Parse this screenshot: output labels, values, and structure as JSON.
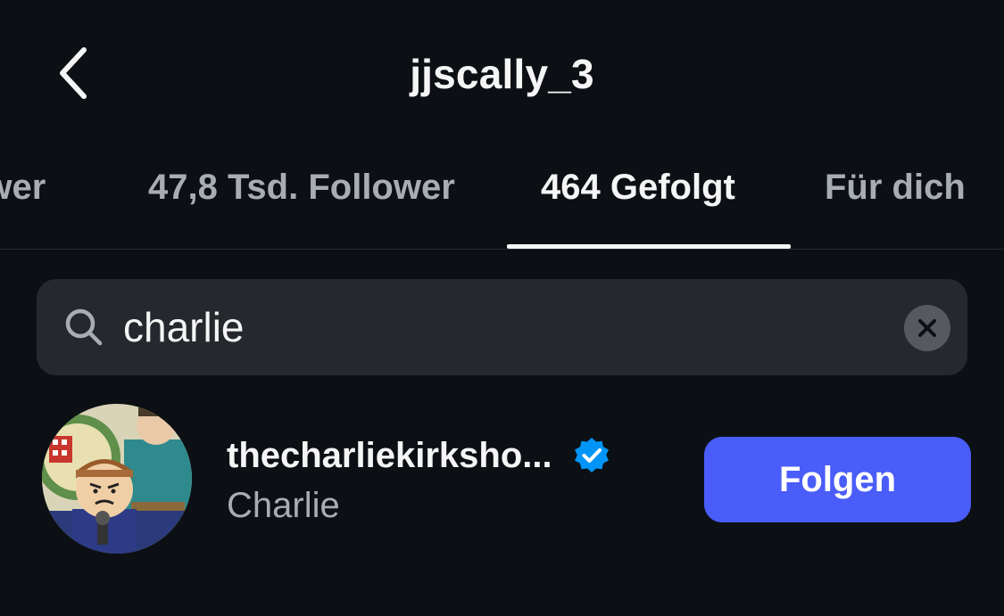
{
  "header": {
    "title": "jjscally_3",
    "back_icon": "chevron-left-icon"
  },
  "tabs": [
    {
      "label": "ower",
      "active": false
    },
    {
      "label": "47,8 Tsd. Follower",
      "active": false
    },
    {
      "label": "464 Gefolgt",
      "active": true
    },
    {
      "label": "Für dich",
      "active": false
    }
  ],
  "search": {
    "value": "charlie",
    "icon": "search-icon",
    "clear_icon": "close-icon"
  },
  "results": [
    {
      "username": "thecharliekirksho...",
      "verified": true,
      "full_name": "Charlie",
      "follow_label": "Folgen"
    }
  ],
  "colors": {
    "background": "#0c1014",
    "accent": "#4a5df9",
    "verified": "#0095f6",
    "secondary_text": "#a8adb3"
  }
}
